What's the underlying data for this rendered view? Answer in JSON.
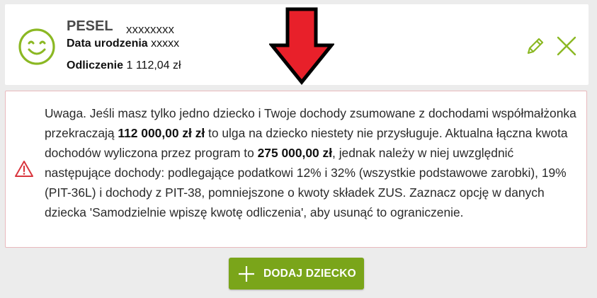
{
  "child": {
    "pesel_label": "PESEL",
    "pesel_value": "xxxxxxxx",
    "birth_label": "Data urodzenia",
    "birth_value": "xxxxx",
    "deduction_label": "Odliczenie",
    "deduction_value": "1 112,04 zł",
    "avatar_icon": "smiley-face-icon",
    "edit_icon": "pencil-icon",
    "remove_icon": "close-icon"
  },
  "warning": {
    "icon": "warning-triangle-icon",
    "part1": "Uwaga. Jeśli masz tylko jedno dziecko i Twoje dochody zsumowane z dochodami współmałżonka przekraczają ",
    "limit": "112 000,00 zł zł",
    "part2": " to ulga na dziecko niestety nie przysługuje. Aktualna łączna kwota dochodów wyliczona przez program to ",
    "total": "275 000,00 zł",
    "part3": ", jednak należy w niej uwzględnić następujące dochody: podlegające podatkowi 12% i 32% (wszystkie podstawowe zarobki), 19% (PIT-36L) i dochody z PIT-38, pomniejszone o kwoty składek ZUS. Zaznacz opcję w danych dziecka 'Samodzielnie wpiszę kwotę odliczenia', aby usunąć to ograniczenie."
  },
  "add_button": {
    "label": "DODAJ DZIECKO",
    "icon": "plus-icon"
  },
  "colors": {
    "accent_green": "#7aa51a",
    "icon_green": "#8bb823",
    "warning_red": "#d9363e",
    "arrow_red": "#e8202a"
  }
}
